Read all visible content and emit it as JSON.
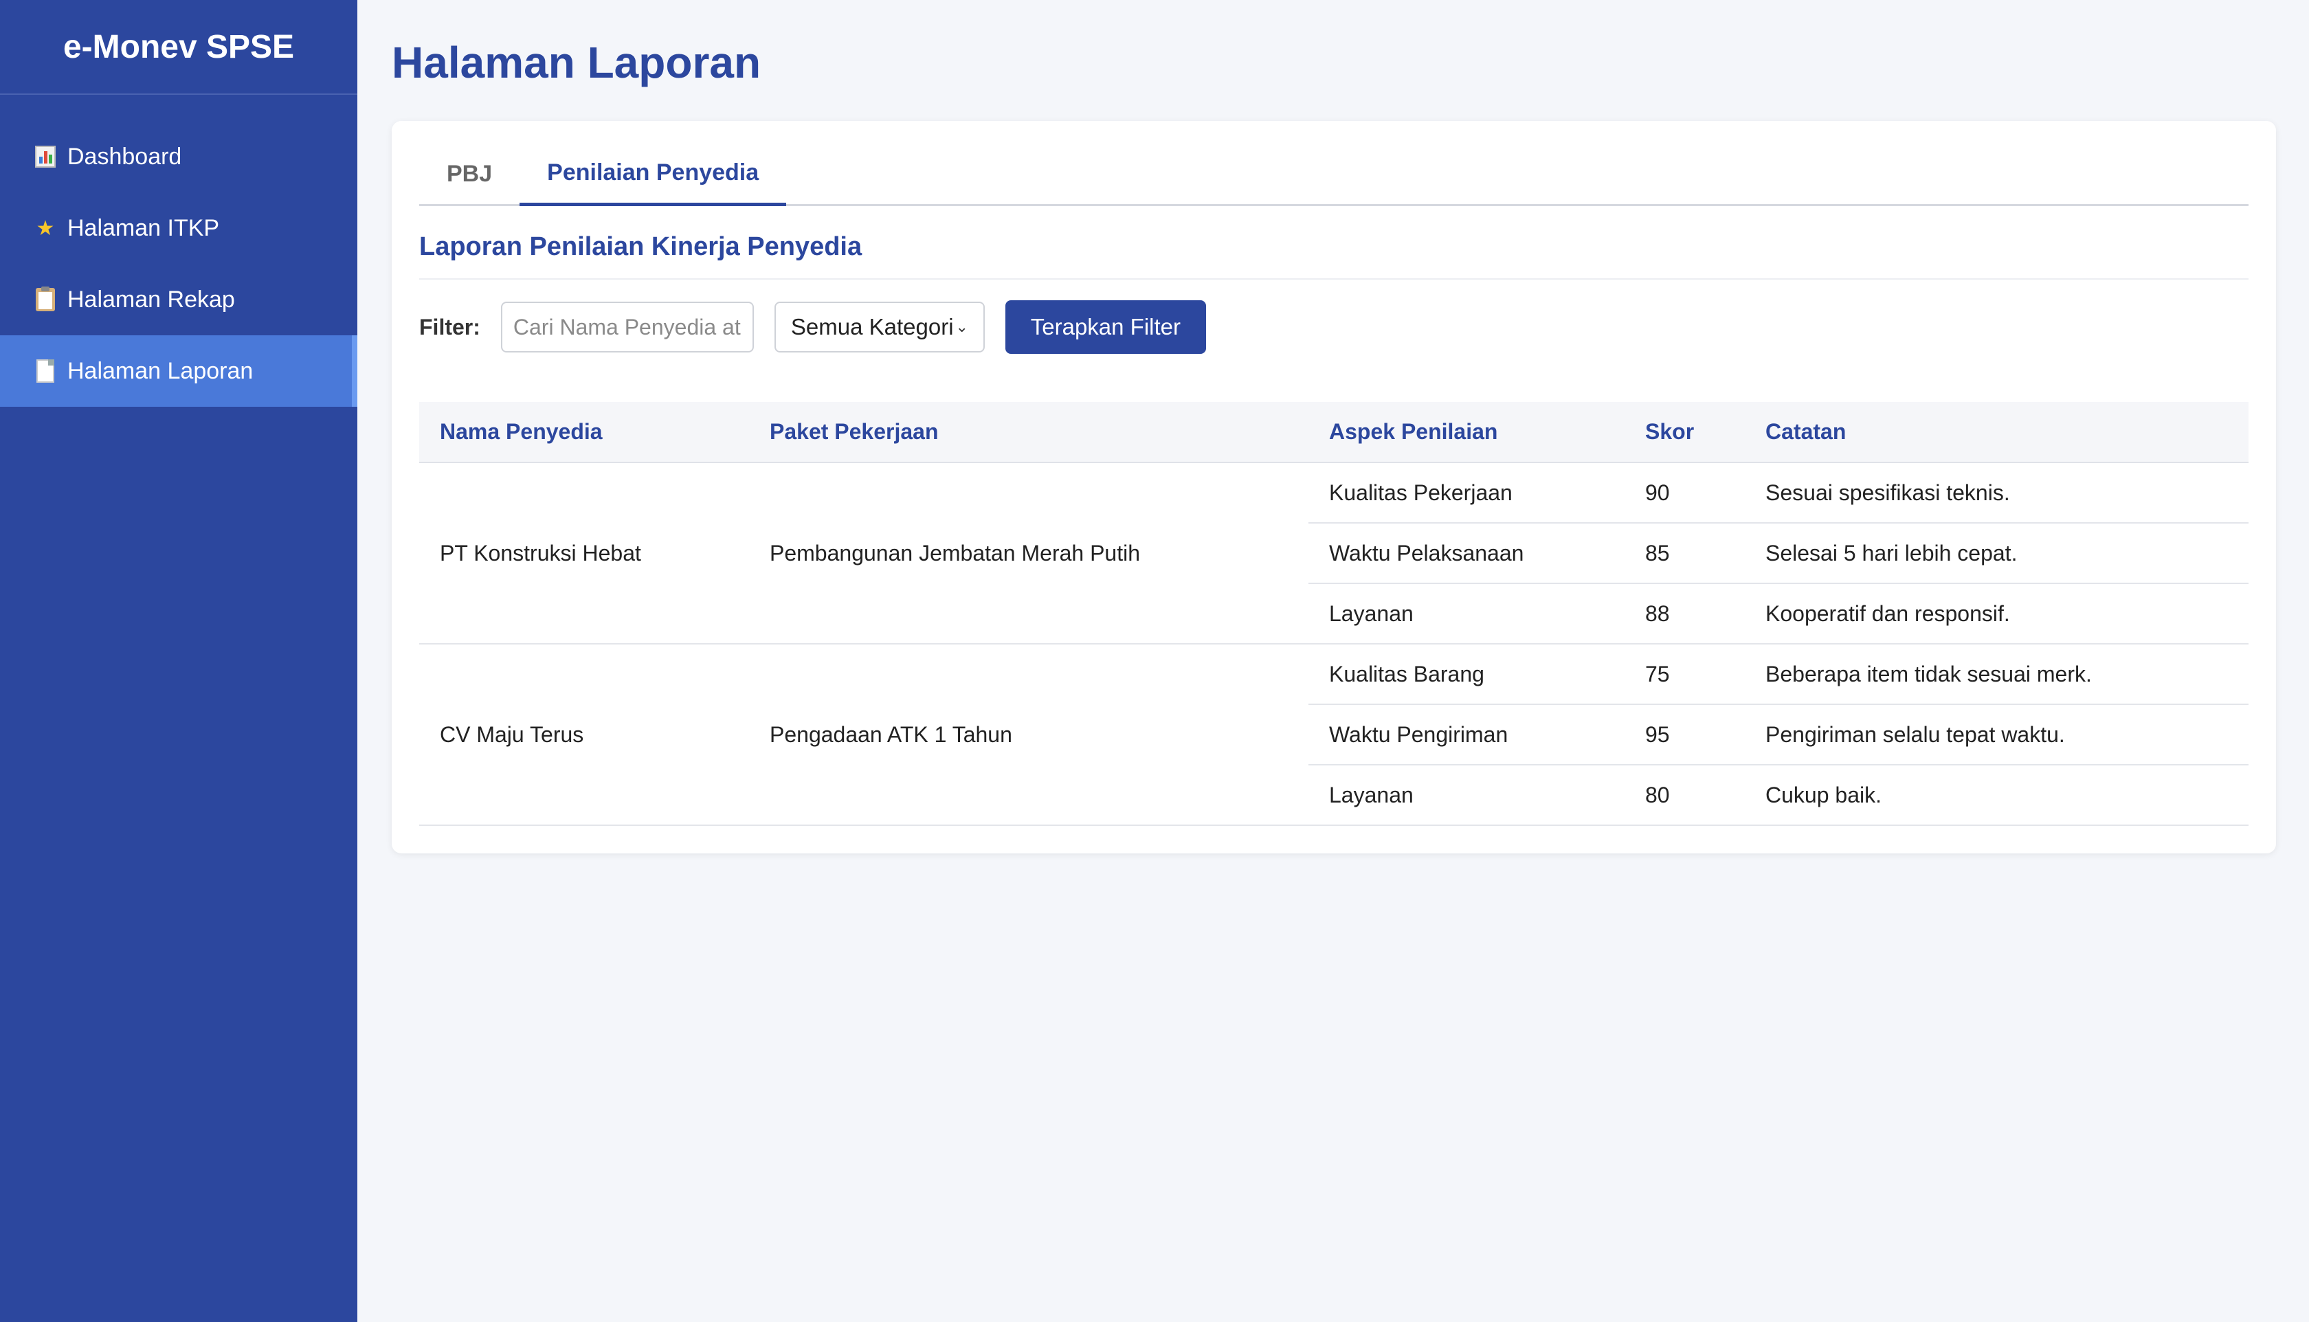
{
  "sidebar": {
    "brand": "e-Monev SPSE",
    "items": [
      {
        "label": "Dashboard",
        "icon": "bar-chart-icon"
      },
      {
        "label": "Halaman ITKP",
        "icon": "star-icon"
      },
      {
        "label": "Halaman Rekap",
        "icon": "clipboard-icon"
      },
      {
        "label": "Halaman Laporan",
        "icon": "page-icon"
      }
    ],
    "active_item": "Halaman Laporan"
  },
  "main": {
    "title": "Halaman Laporan",
    "tabs": [
      {
        "label": "PBJ"
      },
      {
        "label": "Penilaian Penyedia"
      }
    ],
    "active_tab": "Penilaian Penyedia",
    "section_title": "Laporan Penilaian Kinerja Penyedia",
    "filter": {
      "label": "Filter:",
      "search_placeholder": "Cari Nama Penyedia at",
      "search_value": "",
      "category_selected": "Semua Kategori",
      "apply_button": "Terapkan Filter"
    },
    "table": {
      "headers": [
        "Nama Penyedia",
        "Paket Pekerjaan",
        "Aspek Penilaian",
        "Skor",
        "Catatan"
      ],
      "groups": [
        {
          "provider": "PT Konstruksi Hebat",
          "package": "Pembangunan Jembatan Merah Putih",
          "rows": [
            {
              "aspect": "Kualitas Pekerjaan",
              "score": "90",
              "note": "Sesuai spesifikasi teknis."
            },
            {
              "aspect": "Waktu Pelaksanaan",
              "score": "85",
              "note": "Selesai 5 hari lebih cepat."
            },
            {
              "aspect": "Layanan",
              "score": "88",
              "note": "Kooperatif dan responsif."
            }
          ]
        },
        {
          "provider": "CV Maju Terus",
          "package": "Pengadaan ATK 1 Tahun",
          "rows": [
            {
              "aspect": "Kualitas Barang",
              "score": "75",
              "note": "Beberapa item tidak sesuai merk."
            },
            {
              "aspect": "Waktu Pengiriman",
              "score": "95",
              "note": "Pengiriman selalu tepat waktu."
            },
            {
              "aspect": "Layanan",
              "score": "80",
              "note": "Cukup baik."
            }
          ]
        }
      ]
    }
  },
  "colors": {
    "sidebar_bg": "#2c479e",
    "active_item_bg": "#4a79d9",
    "accent": "#2c479e",
    "page_bg": "#f4f6fa"
  }
}
